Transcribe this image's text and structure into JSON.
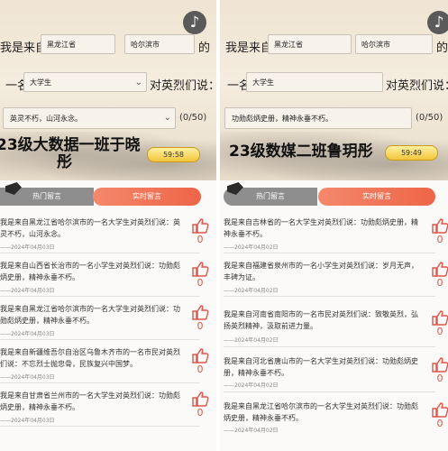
{
  "left": {
    "prefix": "我是来自",
    "province": "黑龙江省",
    "city": "哈尔滨市",
    "of": "的",
    "one": "一名",
    "identity": "大学生",
    "to_martyrs": "对英烈们说：",
    "message": "英灵不朽，山河永念。",
    "counter": "(0/50)",
    "title_line1": "23级大数据一班于晓",
    "title_line2": "彤",
    "timer": "59:58",
    "tab_hot": "热门留言",
    "tab_live": "实时留言",
    "comments": [
      {
        "text": "我是来自黑龙江省哈尔滨市的一名大学生对英烈们说：英灵不朽，山河永念。",
        "date": "——2024年04月03日",
        "likes": "0"
      },
      {
        "text": "我是来自山西省长治市的一名小学生对英烈们说：功勋彪炳史册，精神永垂不朽。",
        "date": "——2024年04月03日",
        "likes": "0"
      },
      {
        "text": "我是来自黑龙江省哈尔滨市的一名大学生对英烈们说：功勋彪炳史册，精神永垂不朽。",
        "date": "——2024年04月03日",
        "likes": "0"
      },
      {
        "text": "我是来自新疆维吾尔自治区乌鲁木齐市的一名市民对英烈们说：不忘烈士抛忠骨，民族复兴中国梦。",
        "date": "——2024年04月03日",
        "likes": "0"
      },
      {
        "text": "我是来自甘肃省兰州市的一名大学生对英烈们说：功勋彪炳史册，精神永垂不朽。",
        "date": "——2024年04月03日",
        "likes": "0"
      }
    ]
  },
  "right": {
    "prefix": "我是来自",
    "province": "黑龙江省",
    "city": "哈尔滨市",
    "of": "的",
    "one": "一名",
    "identity": "大学生",
    "to_martyrs": "对英烈们说：",
    "message": "功勋彪炳史册，精神永垂不朽。",
    "counter": "(0/50)",
    "title_line1": "23级数媒二班鲁玥彤",
    "timer": "59:49",
    "tab_hot": "热门留言",
    "tab_live": "实时留言",
    "comments": [
      {
        "text": "我是来自吉林省的一名大学生对英烈们说：功勋彪炳史册，精神永垂不朽。",
        "date": "——2024年04月02日",
        "likes": "0"
      },
      {
        "text": "我是来自福建省泉州市的一名小学生对英烈们说：岁月无声，丰碑为证。",
        "date": "——2024年04月02日",
        "likes": "0"
      },
      {
        "text": "我是来自河南省南阳市的一名市民对英烈们说：致敬英烈，弘扬英烈精神，汲取前进力量。",
        "date": "——2024年04月02日",
        "likes": "0"
      },
      {
        "text": "我是来自河北省唐山市的一名大学生对英烈们说：功勋彪炳史册，精神永垂不朽。",
        "date": "——2024年04月02日",
        "likes": "0"
      },
      {
        "text": "我是来自黑龙江省哈尔滨市的一名大学生对英烈们说：功勋彪炳史册，精神永垂不朽。",
        "date": "——2024年04月02日",
        "likes": "0"
      }
    ]
  }
}
